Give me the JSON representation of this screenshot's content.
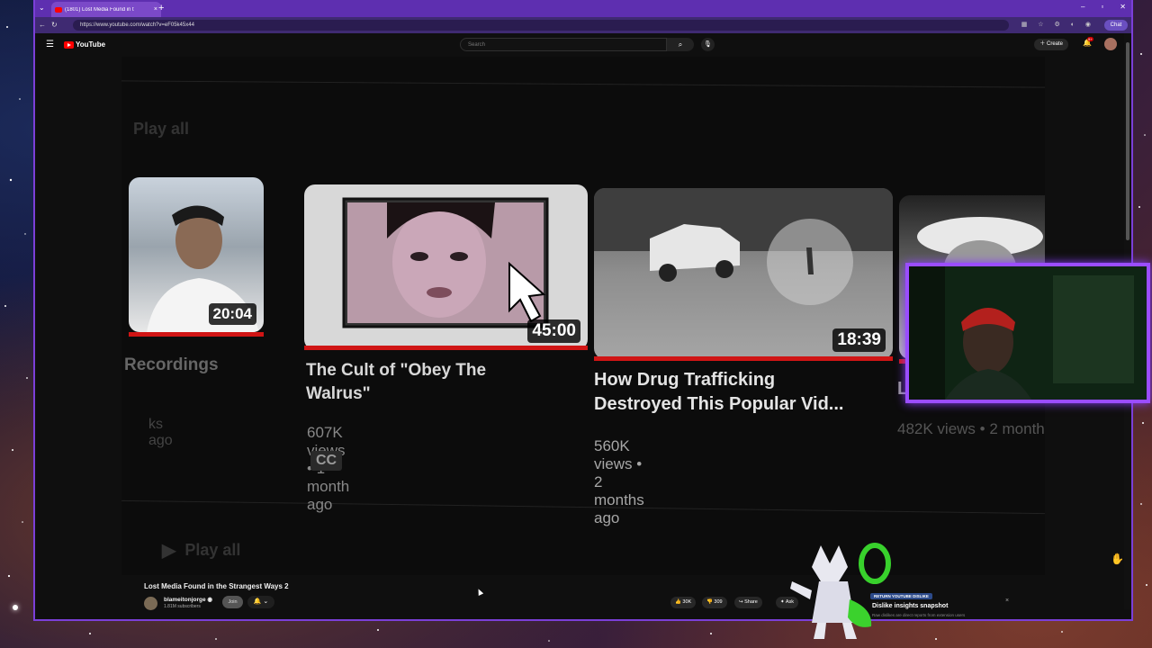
{
  "browser": {
    "tab_title": "(1801) Lost Media Found in t",
    "url": "https://www.youtube.com/watch?v=eF05k45x44",
    "copilot_label": "Chat"
  },
  "youtube": {
    "logo_text": "YouTube",
    "search_placeholder": "Search",
    "create_label": "Create",
    "notification_count": "9+"
  },
  "end_screen": {
    "play_all_top": "Play all",
    "play_all_bottom": "Play all",
    "cards": [
      {
        "title": "Recordings",
        "meta": "ks ago",
        "duration": "20:04"
      },
      {
        "title": "The Cult of \"Obey The Walrus\"",
        "meta": "607K views • 1 month ago",
        "duration": "45:00",
        "badge": "CC"
      },
      {
        "title": "How Drug Trafficking Destroyed This Popular Vid...",
        "meta": "560K views • 2 months ago",
        "duration": "18:39"
      },
      {
        "title": "Lost",
        "meta": "482K views • 2 months"
      }
    ]
  },
  "video": {
    "title": "Lost Media Found in the Strangest Ways 2",
    "channel_name": "blameitonjorge",
    "subscribers": "1.81M subscribers",
    "join_label": "Join",
    "likes": "30K",
    "dislikes": "309",
    "share_label": "Share",
    "ask_label": "Ask"
  },
  "return_dislike": {
    "tag": "RETURN YOUTUBE DISLIKE",
    "title": "Dislike insights snapshot",
    "subtitle": "Raw dislikes are direct reports from extension users"
  },
  "colors": {
    "accent_purple": "#7b3fd8",
    "youtube_red": "#ff0000",
    "progress_red": "#d01515"
  }
}
